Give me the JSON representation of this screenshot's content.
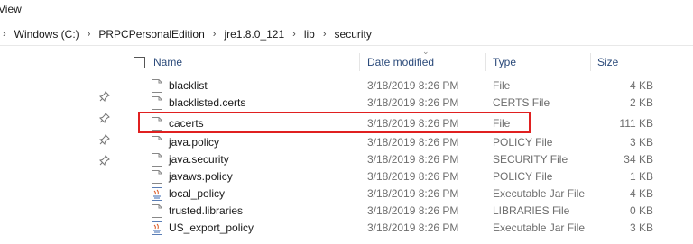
{
  "menu": {
    "view_label": "View"
  },
  "breadcrumb": {
    "items": [
      "Windows (C:)",
      "PRPCPersonalEdition",
      "jre1.8.0_121",
      "lib",
      "security"
    ],
    "separator": "›"
  },
  "columns": {
    "name": "Name",
    "date": "Date modified",
    "type": "Type",
    "size": "Size"
  },
  "files": [
    {
      "name": "blacklist",
      "date": "3/18/2019 8:26 PM",
      "type": "File",
      "size": "4 KB",
      "icon": "file-icon"
    },
    {
      "name": "blacklisted.certs",
      "date": "3/18/2019 8:26 PM",
      "type": "CERTS File",
      "size": "2 KB",
      "icon": "file-icon"
    },
    {
      "name": "cacerts",
      "date": "3/18/2019 8:26 PM",
      "type": "File",
      "size": "111 KB",
      "icon": "file-icon"
    },
    {
      "name": "java.policy",
      "date": "3/18/2019 8:26 PM",
      "type": "POLICY File",
      "size": "3 KB",
      "icon": "file-icon"
    },
    {
      "name": "java.security",
      "date": "3/18/2019 8:26 PM",
      "type": "SECURITY File",
      "size": "34 KB",
      "icon": "file-icon"
    },
    {
      "name": "javaws.policy",
      "date": "3/18/2019 8:26 PM",
      "type": "POLICY File",
      "size": "1 KB",
      "icon": "file-icon"
    },
    {
      "name": "local_policy",
      "date": "3/18/2019 8:26 PM",
      "type": "Executable Jar File",
      "size": "4 KB",
      "icon": "jar-icon"
    },
    {
      "name": "trusted.libraries",
      "date": "3/18/2019 8:26 PM",
      "type": "LIBRARIES File",
      "size": "0 KB",
      "icon": "file-icon"
    },
    {
      "name": "US_export_policy",
      "date": "3/18/2019 8:26 PM",
      "type": "Executable Jar File",
      "size": "3 KB",
      "icon": "jar-icon"
    }
  ],
  "colors": {
    "header_text": "#2b4a7a",
    "detail_text": "#6d6d6d",
    "highlight_border": "#e02020"
  }
}
